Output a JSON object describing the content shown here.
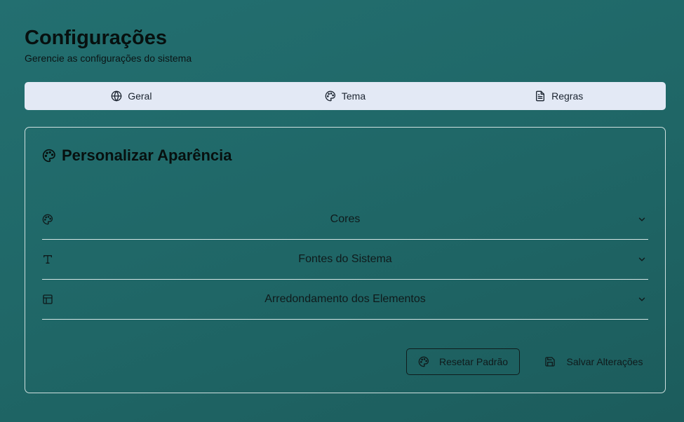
{
  "header": {
    "title": "Configurações",
    "subtitle": "Gerencie as configurações do sistema"
  },
  "tabs": [
    {
      "label": "Geral",
      "icon": "globe-icon"
    },
    {
      "label": "Tema",
      "icon": "palette-icon"
    },
    {
      "label": "Regras",
      "icon": "document-icon"
    }
  ],
  "card": {
    "title": "Personalizar Aparência",
    "title_icon": "palette-icon",
    "sections": [
      {
        "label": "Cores",
        "icon": "palette-icon"
      },
      {
        "label": "Fontes do Sistema",
        "icon": "type-icon"
      },
      {
        "label": "Arredondamento dos Elementos",
        "icon": "layout-icon"
      }
    ],
    "reset_label": "Resetar Padrão",
    "save_label": "Salvar Alterações"
  },
  "colors": {
    "background": "#1f6666",
    "tabs_bg": "#e3e9f5",
    "card_border": "#cfe0df"
  }
}
